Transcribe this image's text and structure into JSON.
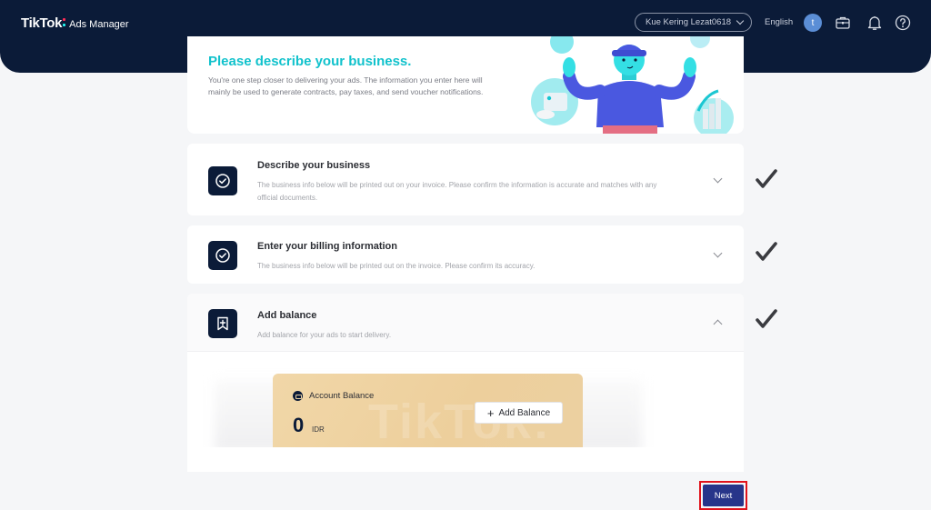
{
  "header": {
    "logo_brand": "TikTok",
    "logo_product": "Ads Manager",
    "account_name": "Kue Kering Lezat0618",
    "language": "English",
    "avatar_initial": "t",
    "icons": [
      "briefcase-icon",
      "bell-icon",
      "help-icon"
    ]
  },
  "hero": {
    "title": "Please describe your business.",
    "description": "You're one step closer to delivering your ads. The information you enter here will mainly be used to generate contracts, pay taxes, and send voucher notifications.",
    "accent_color": "#11c2cc"
  },
  "steps": [
    {
      "title": "Describe your business",
      "description": "The business info below will be printed out on your invoice. Please confirm the information is accurate and matches with any official documents.",
      "icon": "check-circle-icon",
      "expanded": false,
      "completed": true
    },
    {
      "title": "Enter your billing information",
      "description": "The business info below will be printed out on the invoice. Please confirm its accuracy.",
      "icon": "check-circle-icon",
      "expanded": false,
      "completed": true
    },
    {
      "title": "Add balance",
      "description": "Add balance for your ads to start delivery.",
      "icon": "bookmark-plus-icon",
      "expanded": true,
      "completed": true
    }
  ],
  "balance": {
    "label": "Account Balance",
    "amount": "0",
    "currency": "IDR",
    "add_button_label": "Add Balance",
    "watermark": "TikTok:"
  },
  "footer": {
    "next_label": "Next",
    "next_color": "#27358a",
    "highlight_color": "#e0121b"
  },
  "colors": {
    "header_bg": "#0b1b38",
    "page_bg": "#f5f6f8"
  }
}
